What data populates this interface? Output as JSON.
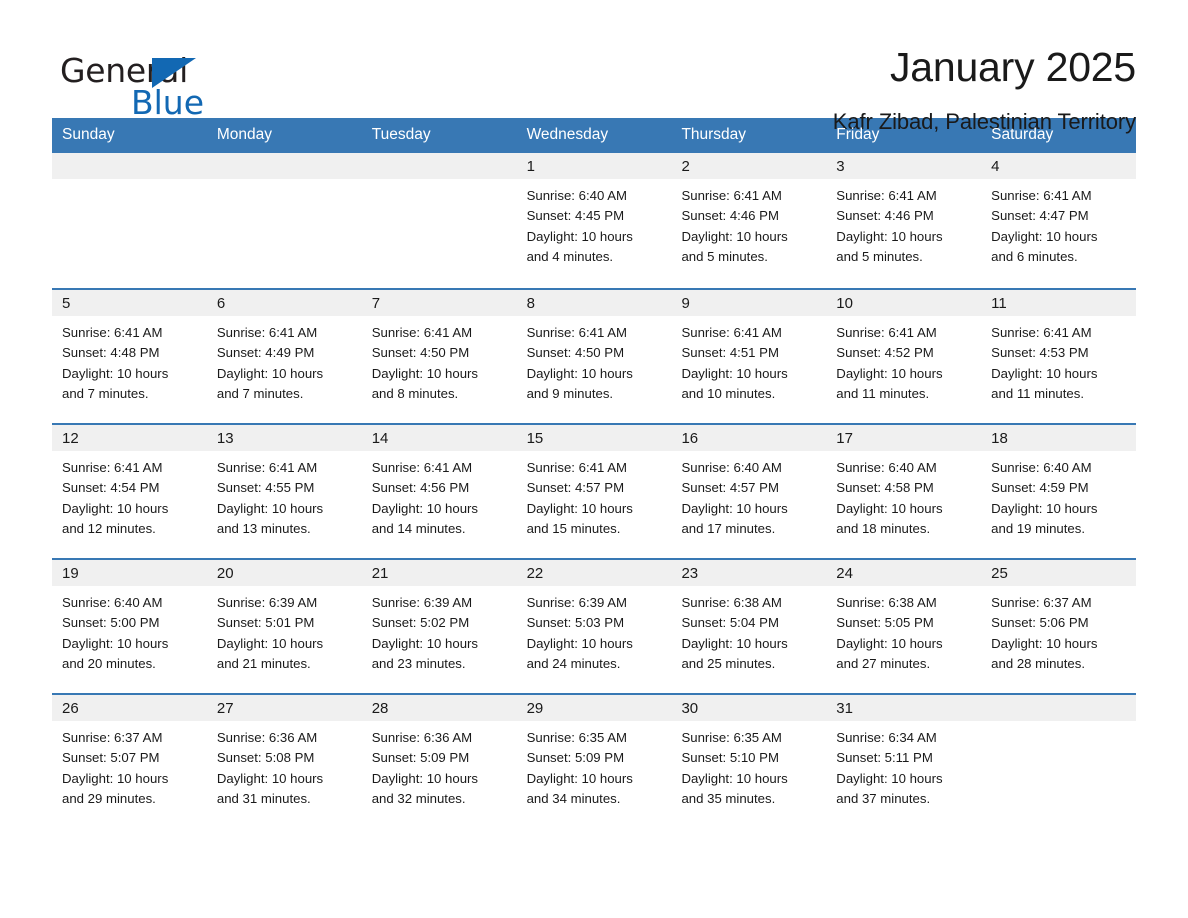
{
  "logo": {
    "word1": "General",
    "word2": "Blue",
    "brand_color": "#1268b3"
  },
  "header": {
    "title": "January 2025",
    "subtitle": "Kafr Zibad, Palestinian Territory"
  },
  "calendar": {
    "accent_color": "#3878b4",
    "day_band_color": "#f0f0f0",
    "weekday_headers": [
      "Sunday",
      "Monday",
      "Tuesday",
      "Wednesday",
      "Thursday",
      "Friday",
      "Saturday"
    ],
    "weeks": [
      [
        {
          "day": "",
          "blank": true
        },
        {
          "day": "",
          "blank": true
        },
        {
          "day": "",
          "blank": true
        },
        {
          "day": "1",
          "sunrise": "Sunrise: 6:40 AM",
          "sunset": "Sunset: 4:45 PM",
          "daylight_line1": "Daylight: 10 hours",
          "daylight_line2": "and 4 minutes."
        },
        {
          "day": "2",
          "sunrise": "Sunrise: 6:41 AM",
          "sunset": "Sunset: 4:46 PM",
          "daylight_line1": "Daylight: 10 hours",
          "daylight_line2": "and 5 minutes."
        },
        {
          "day": "3",
          "sunrise": "Sunrise: 6:41 AM",
          "sunset": "Sunset: 4:46 PM",
          "daylight_line1": "Daylight: 10 hours",
          "daylight_line2": "and 5 minutes."
        },
        {
          "day": "4",
          "sunrise": "Sunrise: 6:41 AM",
          "sunset": "Sunset: 4:47 PM",
          "daylight_line1": "Daylight: 10 hours",
          "daylight_line2": "and 6 minutes."
        }
      ],
      [
        {
          "day": "5",
          "sunrise": "Sunrise: 6:41 AM",
          "sunset": "Sunset: 4:48 PM",
          "daylight_line1": "Daylight: 10 hours",
          "daylight_line2": "and 7 minutes."
        },
        {
          "day": "6",
          "sunrise": "Sunrise: 6:41 AM",
          "sunset": "Sunset: 4:49 PM",
          "daylight_line1": "Daylight: 10 hours",
          "daylight_line2": "and 7 minutes."
        },
        {
          "day": "7",
          "sunrise": "Sunrise: 6:41 AM",
          "sunset": "Sunset: 4:50 PM",
          "daylight_line1": "Daylight: 10 hours",
          "daylight_line2": "and 8 minutes."
        },
        {
          "day": "8",
          "sunrise": "Sunrise: 6:41 AM",
          "sunset": "Sunset: 4:50 PM",
          "daylight_line1": "Daylight: 10 hours",
          "daylight_line2": "and 9 minutes."
        },
        {
          "day": "9",
          "sunrise": "Sunrise: 6:41 AM",
          "sunset": "Sunset: 4:51 PM",
          "daylight_line1": "Daylight: 10 hours",
          "daylight_line2": "and 10 minutes."
        },
        {
          "day": "10",
          "sunrise": "Sunrise: 6:41 AM",
          "sunset": "Sunset: 4:52 PM",
          "daylight_line1": "Daylight: 10 hours",
          "daylight_line2": "and 11 minutes."
        },
        {
          "day": "11",
          "sunrise": "Sunrise: 6:41 AM",
          "sunset": "Sunset: 4:53 PM",
          "daylight_line1": "Daylight: 10 hours",
          "daylight_line2": "and 11 minutes."
        }
      ],
      [
        {
          "day": "12",
          "sunrise": "Sunrise: 6:41 AM",
          "sunset": "Sunset: 4:54 PM",
          "daylight_line1": "Daylight: 10 hours",
          "daylight_line2": "and 12 minutes."
        },
        {
          "day": "13",
          "sunrise": "Sunrise: 6:41 AM",
          "sunset": "Sunset: 4:55 PM",
          "daylight_line1": "Daylight: 10 hours",
          "daylight_line2": "and 13 minutes."
        },
        {
          "day": "14",
          "sunrise": "Sunrise: 6:41 AM",
          "sunset": "Sunset: 4:56 PM",
          "daylight_line1": "Daylight: 10 hours",
          "daylight_line2": "and 14 minutes."
        },
        {
          "day": "15",
          "sunrise": "Sunrise: 6:41 AM",
          "sunset": "Sunset: 4:57 PM",
          "daylight_line1": "Daylight: 10 hours",
          "daylight_line2": "and 15 minutes."
        },
        {
          "day": "16",
          "sunrise": "Sunrise: 6:40 AM",
          "sunset": "Sunset: 4:57 PM",
          "daylight_line1": "Daylight: 10 hours",
          "daylight_line2": "and 17 minutes."
        },
        {
          "day": "17",
          "sunrise": "Sunrise: 6:40 AM",
          "sunset": "Sunset: 4:58 PM",
          "daylight_line1": "Daylight: 10 hours",
          "daylight_line2": "and 18 minutes."
        },
        {
          "day": "18",
          "sunrise": "Sunrise: 6:40 AM",
          "sunset": "Sunset: 4:59 PM",
          "daylight_line1": "Daylight: 10 hours",
          "daylight_line2": "and 19 minutes."
        }
      ],
      [
        {
          "day": "19",
          "sunrise": "Sunrise: 6:40 AM",
          "sunset": "Sunset: 5:00 PM",
          "daylight_line1": "Daylight: 10 hours",
          "daylight_line2": "and 20 minutes."
        },
        {
          "day": "20",
          "sunrise": "Sunrise: 6:39 AM",
          "sunset": "Sunset: 5:01 PM",
          "daylight_line1": "Daylight: 10 hours",
          "daylight_line2": "and 21 minutes."
        },
        {
          "day": "21",
          "sunrise": "Sunrise: 6:39 AM",
          "sunset": "Sunset: 5:02 PM",
          "daylight_line1": "Daylight: 10 hours",
          "daylight_line2": "and 23 minutes."
        },
        {
          "day": "22",
          "sunrise": "Sunrise: 6:39 AM",
          "sunset": "Sunset: 5:03 PM",
          "daylight_line1": "Daylight: 10 hours",
          "daylight_line2": "and 24 minutes."
        },
        {
          "day": "23",
          "sunrise": "Sunrise: 6:38 AM",
          "sunset": "Sunset: 5:04 PM",
          "daylight_line1": "Daylight: 10 hours",
          "daylight_line2": "and 25 minutes."
        },
        {
          "day": "24",
          "sunrise": "Sunrise: 6:38 AM",
          "sunset": "Sunset: 5:05 PM",
          "daylight_line1": "Daylight: 10 hours",
          "daylight_line2": "and 27 minutes."
        },
        {
          "day": "25",
          "sunrise": "Sunrise: 6:37 AM",
          "sunset": "Sunset: 5:06 PM",
          "daylight_line1": "Daylight: 10 hours",
          "daylight_line2": "and 28 minutes."
        }
      ],
      [
        {
          "day": "26",
          "sunrise": "Sunrise: 6:37 AM",
          "sunset": "Sunset: 5:07 PM",
          "daylight_line1": "Daylight: 10 hours",
          "daylight_line2": "and 29 minutes."
        },
        {
          "day": "27",
          "sunrise": "Sunrise: 6:36 AM",
          "sunset": "Sunset: 5:08 PM",
          "daylight_line1": "Daylight: 10 hours",
          "daylight_line2": "and 31 minutes."
        },
        {
          "day": "28",
          "sunrise": "Sunrise: 6:36 AM",
          "sunset": "Sunset: 5:09 PM",
          "daylight_line1": "Daylight: 10 hours",
          "daylight_line2": "and 32 minutes."
        },
        {
          "day": "29",
          "sunrise": "Sunrise: 6:35 AM",
          "sunset": "Sunset: 5:09 PM",
          "daylight_line1": "Daylight: 10 hours",
          "daylight_line2": "and 34 minutes."
        },
        {
          "day": "30",
          "sunrise": "Sunrise: 6:35 AM",
          "sunset": "Sunset: 5:10 PM",
          "daylight_line1": "Daylight: 10 hours",
          "daylight_line2": "and 35 minutes."
        },
        {
          "day": "31",
          "sunrise": "Sunrise: 6:34 AM",
          "sunset": "Sunset: 5:11 PM",
          "daylight_line1": "Daylight: 10 hours",
          "daylight_line2": "and 37 minutes."
        },
        {
          "day": "",
          "blank": true
        }
      ]
    ]
  }
}
